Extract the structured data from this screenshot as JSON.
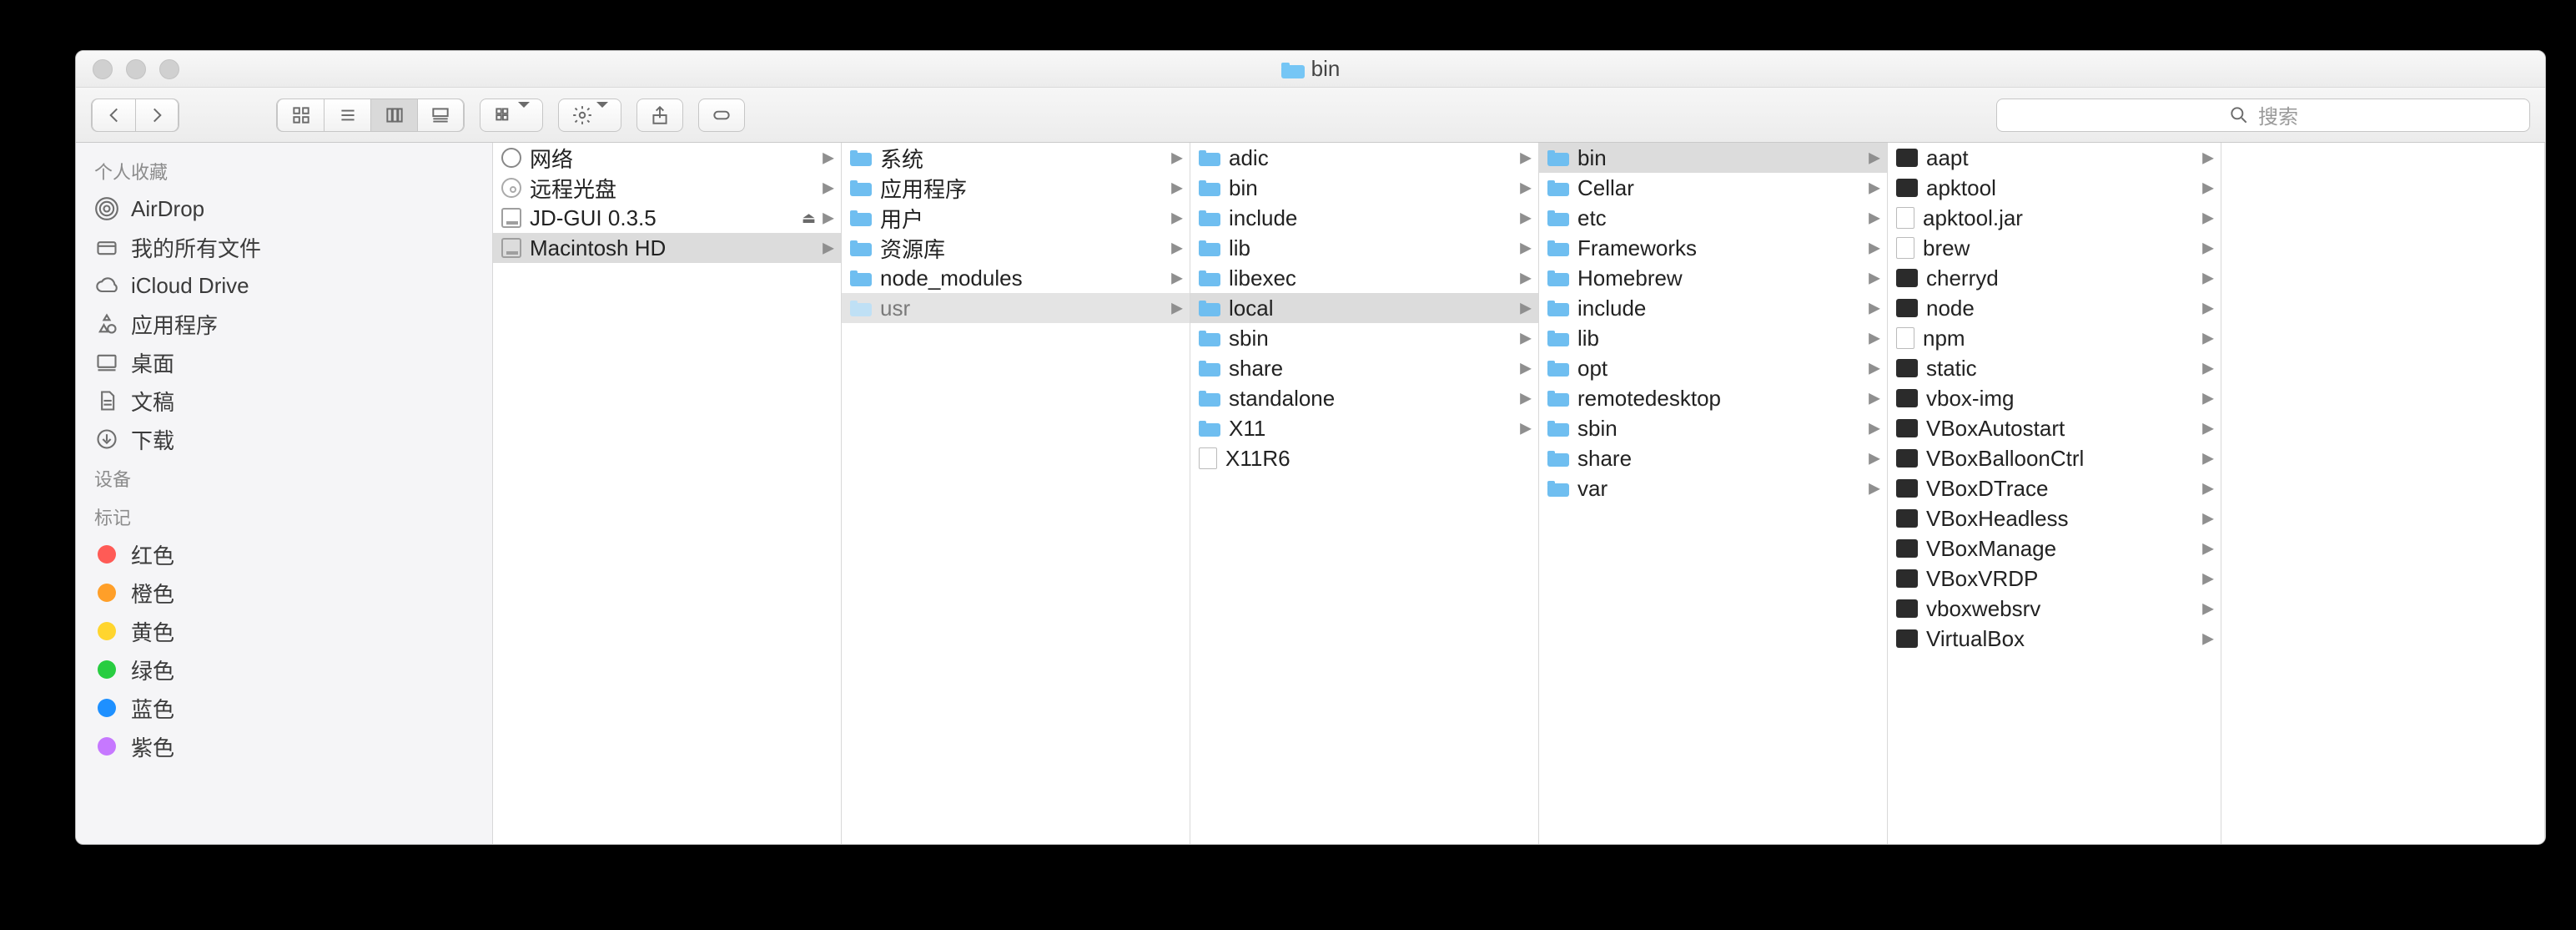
{
  "title_folder": "bin",
  "search_placeholder": "搜索",
  "sidebar": {
    "favorites_header": "个人收藏",
    "devices_header": "设备",
    "tags_header": "标记",
    "favorites": [
      {
        "id": "airdrop",
        "label": "AirDrop",
        "icon": "airdrop"
      },
      {
        "id": "allfiles",
        "label": "我的所有文件",
        "icon": "allfiles"
      },
      {
        "id": "icloud",
        "label": "iCloud Drive",
        "icon": "cloud"
      },
      {
        "id": "apps",
        "label": "应用程序",
        "icon": "apps"
      },
      {
        "id": "desktop",
        "label": "桌面",
        "icon": "desktop"
      },
      {
        "id": "docs",
        "label": "文稿",
        "icon": "docs"
      },
      {
        "id": "downloads",
        "label": "下载",
        "icon": "downloads"
      }
    ],
    "tags": [
      {
        "label": "红色",
        "color": "#ff5b56"
      },
      {
        "label": "橙色",
        "color": "#ff9f29"
      },
      {
        "label": "黄色",
        "color": "#ffd52e"
      },
      {
        "label": "绿色",
        "color": "#28cd41"
      },
      {
        "label": "蓝色",
        "color": "#1e90ff"
      },
      {
        "label": "紫色",
        "color": "#c678ff"
      }
    ]
  },
  "columns": [
    {
      "width_class": "col0",
      "items": [
        {
          "label": "网络",
          "icon": "globe",
          "arrow": true
        },
        {
          "label": "远程光盘",
          "icon": "cd",
          "arrow": true
        },
        {
          "label": "JD-GUI 0.3.5",
          "icon": "disk",
          "arrow": true,
          "eject": true
        },
        {
          "label": "Macintosh HD",
          "icon": "disk",
          "arrow": true,
          "selected": true
        }
      ]
    },
    {
      "width_class": "col1",
      "items": [
        {
          "label": "系统",
          "icon": "folder",
          "arrow": true
        },
        {
          "label": "应用程序",
          "icon": "folder",
          "arrow": true
        },
        {
          "label": "用户",
          "icon": "folder",
          "arrow": true
        },
        {
          "label": "资源库",
          "icon": "folder",
          "arrow": true
        },
        {
          "label": "node_modules",
          "icon": "folder",
          "arrow": true
        },
        {
          "label": "usr",
          "icon": "folder",
          "arrow": true,
          "selected": true,
          "dim": true
        }
      ]
    },
    {
      "width_class": "col2",
      "items": [
        {
          "label": "adic",
          "icon": "folder",
          "arrow": true
        },
        {
          "label": "bin",
          "icon": "folder",
          "arrow": true
        },
        {
          "label": "include",
          "icon": "folder",
          "arrow": true
        },
        {
          "label": "lib",
          "icon": "folder",
          "arrow": true
        },
        {
          "label": "libexec",
          "icon": "folder",
          "arrow": true
        },
        {
          "label": "local",
          "icon": "folder",
          "arrow": true,
          "selected": true
        },
        {
          "label": "sbin",
          "icon": "folder",
          "arrow": true
        },
        {
          "label": "share",
          "icon": "folder",
          "arrow": true
        },
        {
          "label": "standalone",
          "icon": "folder",
          "arrow": true
        },
        {
          "label": "X11",
          "icon": "folder",
          "arrow": true
        },
        {
          "label": "X11R6",
          "icon": "doc",
          "arrow": false
        }
      ]
    },
    {
      "width_class": "col3",
      "items": [
        {
          "label": "bin",
          "icon": "folder",
          "arrow": true,
          "selected": true
        },
        {
          "label": "Cellar",
          "icon": "folder",
          "arrow": true
        },
        {
          "label": "etc",
          "icon": "folder",
          "arrow": true
        },
        {
          "label": "Frameworks",
          "icon": "folder",
          "arrow": true
        },
        {
          "label": "Homebrew",
          "icon": "folder",
          "arrow": true
        },
        {
          "label": "include",
          "icon": "folder",
          "arrow": true
        },
        {
          "label": "lib",
          "icon": "folder",
          "arrow": true
        },
        {
          "label": "opt",
          "icon": "folder",
          "arrow": true
        },
        {
          "label": "remotedesktop",
          "icon": "folder",
          "arrow": true
        },
        {
          "label": "sbin",
          "icon": "folder",
          "arrow": true
        },
        {
          "label": "share",
          "icon": "folder",
          "arrow": true
        },
        {
          "label": "var",
          "icon": "folder",
          "arrow": true
        }
      ]
    },
    {
      "width_class": "col4",
      "items": [
        {
          "label": "aapt",
          "icon": "exec",
          "arrow": true
        },
        {
          "label": "apktool",
          "icon": "exec",
          "arrow": true
        },
        {
          "label": "apktool.jar",
          "icon": "doc",
          "arrow": true
        },
        {
          "label": "brew",
          "icon": "doc",
          "arrow": true
        },
        {
          "label": "cherryd",
          "icon": "exec",
          "arrow": true
        },
        {
          "label": "node",
          "icon": "exec",
          "arrow": true
        },
        {
          "label": "npm",
          "icon": "doc",
          "arrow": true
        },
        {
          "label": "static",
          "icon": "exec",
          "arrow": true
        },
        {
          "label": "vbox-img",
          "icon": "exec",
          "arrow": true
        },
        {
          "label": "VBoxAutostart",
          "icon": "exec",
          "arrow": true
        },
        {
          "label": "VBoxBalloonCtrl",
          "icon": "exec",
          "arrow": true
        },
        {
          "label": "VBoxDTrace",
          "icon": "exec",
          "arrow": true
        },
        {
          "label": "VBoxHeadless",
          "icon": "exec",
          "arrow": true
        },
        {
          "label": "VBoxManage",
          "icon": "exec",
          "arrow": true
        },
        {
          "label": "VBoxVRDP",
          "icon": "exec",
          "arrow": true
        },
        {
          "label": "vboxwebsrv",
          "icon": "exec",
          "arrow": true
        },
        {
          "label": "VirtualBox",
          "icon": "exec",
          "arrow": true
        }
      ]
    },
    {
      "width_class": "col5",
      "items": []
    }
  ]
}
